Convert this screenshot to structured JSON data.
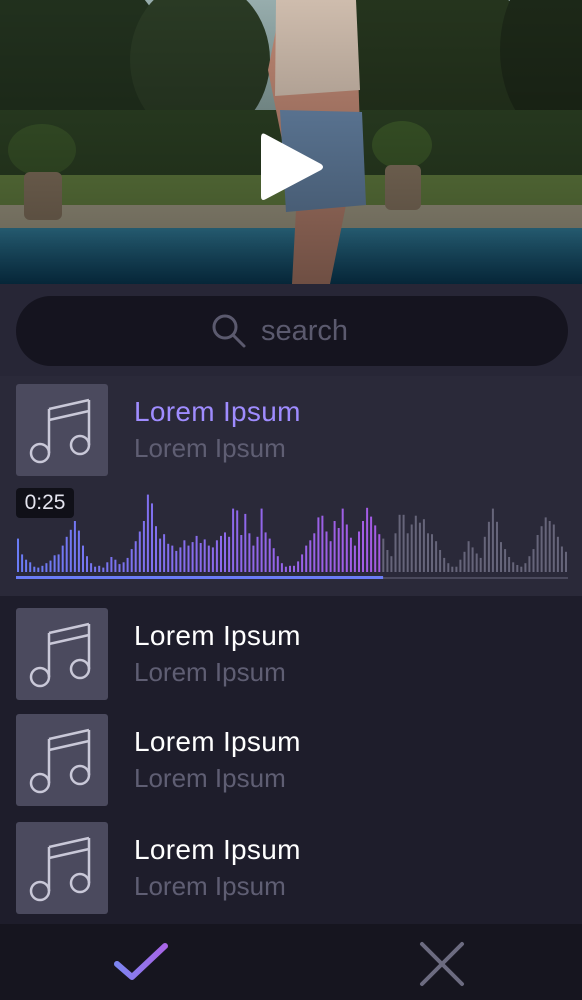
{
  "video": {
    "play_icon": "play-icon"
  },
  "search": {
    "placeholder": "search",
    "icon": "search-icon"
  },
  "selected_track": {
    "title": "Lorem Ipsum",
    "subtitle": "Lorem Ipsum",
    "time": "0:25",
    "progress": 0.665,
    "waveform": [
      0.38,
      0.2,
      0.14,
      0.11,
      0.06,
      0.05,
      0.07,
      0.1,
      0.13,
      0.19,
      0.2,
      0.3,
      0.4,
      0.48,
      0.58,
      0.47,
      0.3,
      0.18,
      0.1,
      0.06,
      0.07,
      0.05,
      0.11,
      0.17,
      0.14,
      0.09,
      0.11,
      0.16,
      0.26,
      0.35,
      0.46,
      0.58,
      0.88,
      0.78,
      0.52,
      0.38,
      0.43,
      0.32,
      0.3,
      0.24,
      0.28,
      0.36,
      0.3,
      0.34,
      0.41,
      0.33,
      0.37,
      0.3,
      0.28,
      0.36,
      0.41,
      0.45,
      0.4,
      0.72,
      0.7,
      0.42,
      0.66,
      0.44,
      0.3,
      0.4,
      0.72,
      0.45,
      0.38,
      0.27,
      0.18,
      0.1,
      0.06,
      0.07,
      0.07,
      0.12,
      0.2,
      0.3,
      0.36,
      0.44,
      0.62,
      0.64,
      0.46,
      0.35,
      0.58,
      0.5,
      0.72,
      0.54,
      0.39,
      0.3,
      0.46,
      0.58,
      0.73,
      0.63,
      0.53,
      0.43,
      0.38,
      0.25,
      0.18,
      0.44,
      0.65,
      0.65,
      0.44,
      0.54,
      0.64,
      0.56,
      0.6,
      0.44,
      0.43,
      0.35,
      0.25,
      0.16,
      0.1,
      0.06,
      0.06,
      0.14,
      0.23,
      0.35,
      0.28,
      0.21,
      0.16,
      0.4,
      0.57,
      0.72,
      0.57,
      0.34,
      0.26,
      0.17,
      0.11,
      0.08,
      0.06,
      0.1,
      0.18,
      0.26,
      0.42,
      0.52,
      0.62,
      0.58,
      0.54,
      0.4,
      0.29,
      0.23
    ],
    "colors": {
      "title": "#9f8cff",
      "played_start": "#6a7cf5",
      "played_end": "#a65be4",
      "unplayed": "#66657a"
    }
  },
  "tracks": [
    {
      "title": "Lorem Ipsum",
      "subtitle": "Lorem Ipsum"
    },
    {
      "title": "Lorem Ipsum",
      "subtitle": "Lorem Ipsum"
    },
    {
      "title": "Lorem Ipsum",
      "subtitle": "Lorem Ipsum"
    }
  ],
  "bottom_bar": {
    "confirm_icon": "check-icon",
    "cancel_icon": "close-icon"
  },
  "colors": {
    "accent": "#9b7ff6",
    "background": "#1e1d2b",
    "thumb": "#4b4a5e"
  }
}
